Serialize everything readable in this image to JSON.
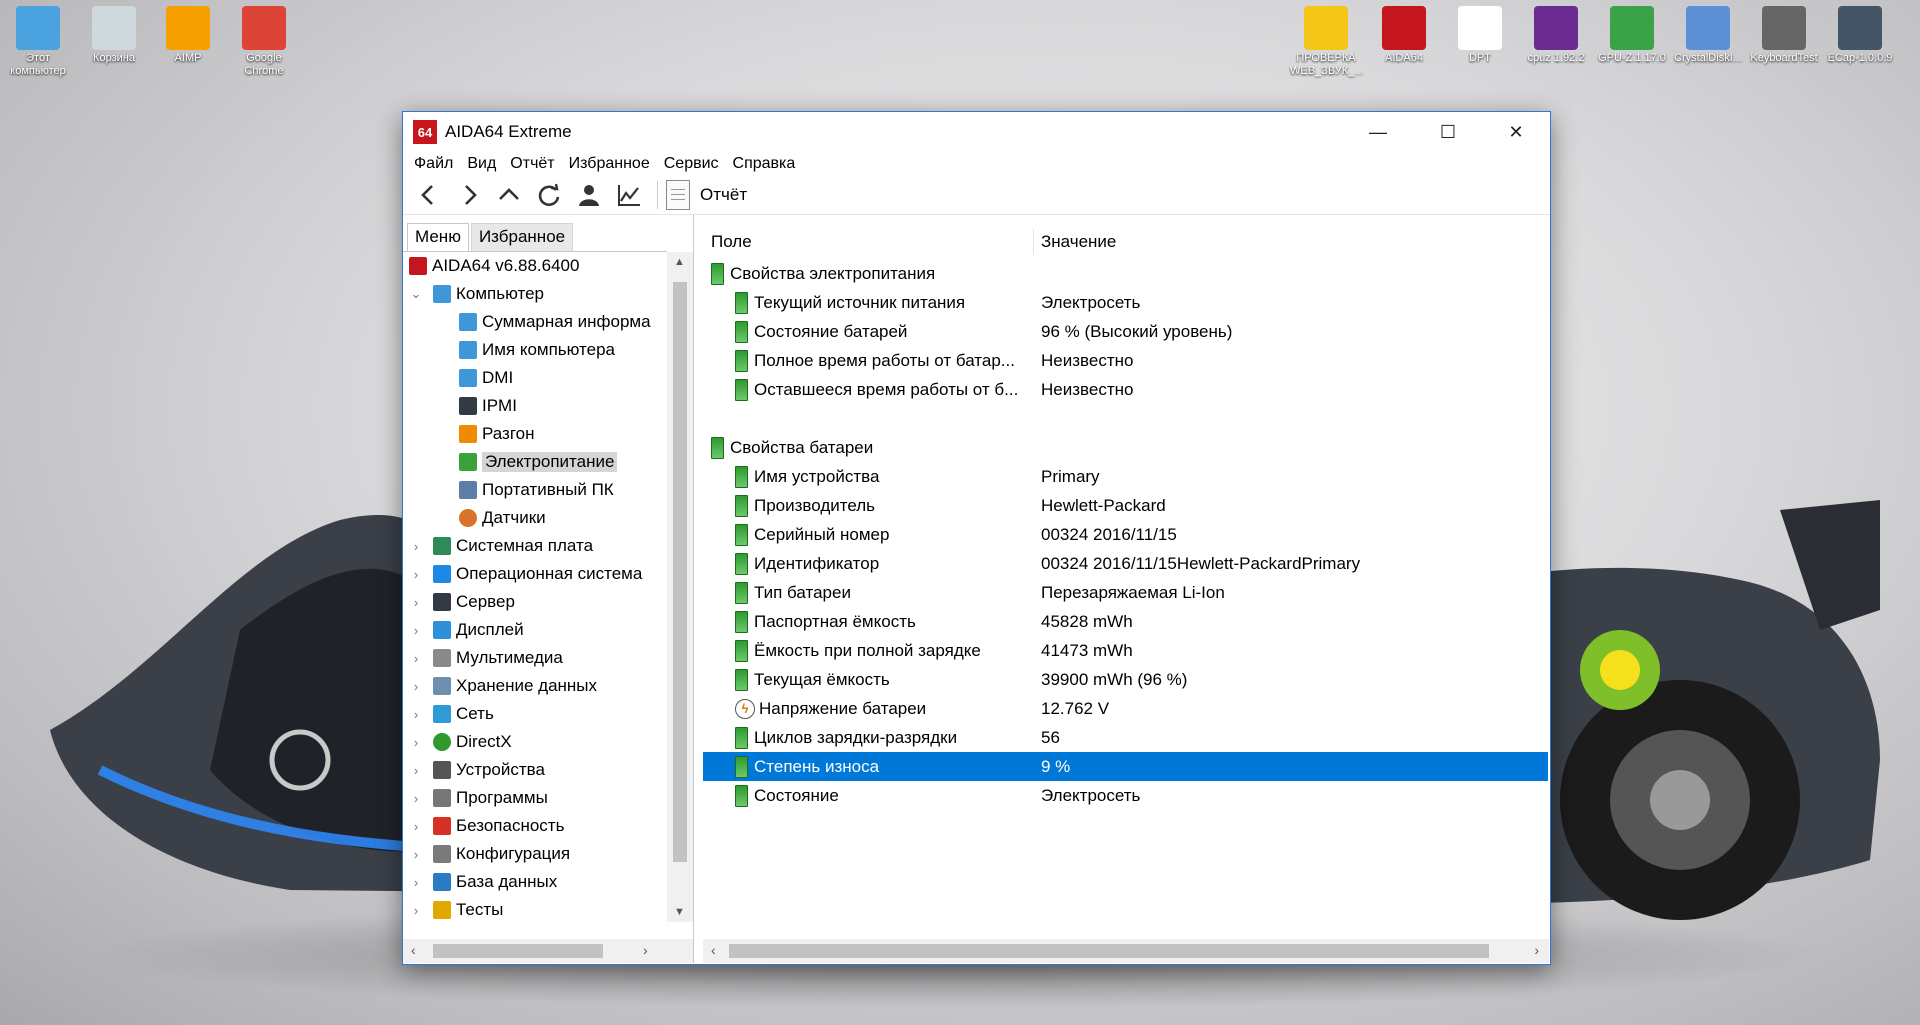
{
  "desktop_icons": [
    {
      "label": "Этот компьютер",
      "name": "this-pc-icon",
      "color": "#4aa3df"
    },
    {
      "label": "Корзина",
      "name": "recycle-bin-icon",
      "color": "#cfd8dc"
    },
    {
      "label": "AIMP",
      "name": "aimp-icon",
      "color": "#f5a000"
    },
    {
      "label": "Google Chrome",
      "name": "chrome-icon",
      "color": "#db4437"
    },
    {
      "label": "ПРОВЕРКА WEB_ЗВУК_...",
      "name": "warning-icon",
      "color": "#f5c518"
    },
    {
      "label": "AIDA64",
      "name": "aida64-icon",
      "color": "#c4161c"
    },
    {
      "label": "DPT",
      "name": "dpt-icon",
      "color": "#ffffff"
    },
    {
      "label": "cpuz 1.92.2",
      "name": "cpuz-icon",
      "color": "#6b2c91"
    },
    {
      "label": "GPU-Z.1.17.0",
      "name": "gpuz-icon",
      "color": "#3aa34a"
    },
    {
      "label": "CrystalDiskI...",
      "name": "crystaldisk-icon",
      "color": "#5b8fd6"
    },
    {
      "label": "KeyboardTest",
      "name": "keyboard-icon",
      "color": "#666666"
    },
    {
      "label": "ECap-1.0.0.9",
      "name": "camera-icon",
      "color": "#445566"
    }
  ],
  "window": {
    "title": "AIDA64 Extreme",
    "logo": "64",
    "controls": {
      "minimize": "—",
      "maximize": "☐",
      "close": "✕"
    }
  },
  "menu": [
    "Файл",
    "Вид",
    "Отчёт",
    "Избранное",
    "Сервис",
    "Справка"
  ],
  "toolbar": {
    "report_label": "Отчёт"
  },
  "tabs": {
    "menu": "Меню",
    "favorites": "Избранное"
  },
  "tree": [
    {
      "label": "AIDA64 v6.88.6400",
      "level": 0,
      "icon": "aida64-icon",
      "arrow": ""
    },
    {
      "label": "Компьютер",
      "level": 1,
      "icon": "computer-icon",
      "arrow": "⌄"
    },
    {
      "label": "Суммарная информа",
      "level": 2,
      "icon": "computer-icon",
      "arrow": ""
    },
    {
      "label": "Имя компьютера",
      "level": 2,
      "icon": "computer-icon",
      "arrow": ""
    },
    {
      "label": "DMI",
      "level": 2,
      "icon": "computer-icon",
      "arrow": ""
    },
    {
      "label": "IPMI",
      "level": 2,
      "icon": "server-icon",
      "arrow": ""
    },
    {
      "label": "Разгон",
      "level": 2,
      "icon": "flame-icon",
      "arrow": ""
    },
    {
      "label": "Электропитание",
      "level": 2,
      "icon": "battery-icon",
      "arrow": "",
      "selected": true
    },
    {
      "label": "Портативный ПК",
      "level": 2,
      "icon": "laptop-icon",
      "arrow": ""
    },
    {
      "label": "Датчики",
      "level": 2,
      "icon": "gauge-icon",
      "arrow": ""
    },
    {
      "label": "Системная плата",
      "level": 1,
      "icon": "motherboard-icon",
      "arrow": "›"
    },
    {
      "label": "Операционная система",
      "level": 1,
      "icon": "windows-icon",
      "arrow": "›"
    },
    {
      "label": "Сервер",
      "level": 1,
      "icon": "server-icon",
      "arrow": "›"
    },
    {
      "label": "Дисплей",
      "level": 1,
      "icon": "display-icon",
      "arrow": "›"
    },
    {
      "label": "Мультимедиа",
      "level": 1,
      "icon": "speaker-icon",
      "arrow": "›"
    },
    {
      "label": "Хранение данных",
      "level": 1,
      "icon": "storage-icon",
      "arrow": "›"
    },
    {
      "label": "Сеть",
      "level": 1,
      "icon": "network-icon",
      "arrow": "›"
    },
    {
      "label": "DirectX",
      "level": 1,
      "icon": "xbox-icon",
      "arrow": "›"
    },
    {
      "label": "Устройства",
      "level": 1,
      "icon": "devices-icon",
      "arrow": "›"
    },
    {
      "label": "Программы",
      "level": 1,
      "icon": "programs-icon",
      "arrow": "›"
    },
    {
      "label": "Безопасность",
      "level": 1,
      "icon": "shield-icon",
      "arrow": "›"
    },
    {
      "label": "Конфигурация",
      "level": 1,
      "icon": "config-icon",
      "arrow": "›"
    },
    {
      "label": "База данных",
      "level": 1,
      "icon": "database-icon",
      "arrow": "›"
    },
    {
      "label": "Тесты",
      "level": 1,
      "icon": "tests-icon",
      "arrow": "›"
    }
  ],
  "columns": {
    "field": "Поле",
    "value": "Значение"
  },
  "rows": [
    {
      "field": "Свойства электропитания",
      "value": "",
      "group": true
    },
    {
      "field": "Текущий источник питания",
      "value": "Электросеть"
    },
    {
      "field": "Состояние батарей",
      "value": "96 % (Высокий уровень)"
    },
    {
      "field": "Полное время работы от батар...",
      "value": "Неизвестно"
    },
    {
      "field": "Оставшееся время работы от б...",
      "value": "Неизвестно"
    },
    {
      "field": "",
      "value": "",
      "spacer": true
    },
    {
      "field": "Свойства батареи",
      "value": "",
      "group": true
    },
    {
      "field": "Имя устройства",
      "value": "Primary"
    },
    {
      "field": "Производитель",
      "value": "Hewlett-Packard"
    },
    {
      "field": "Серийный номер",
      "value": "00324 2016/11/15"
    },
    {
      "field": "Идентификатор",
      "value": "00324 2016/11/15Hewlett-PackardPrimary"
    },
    {
      "field": "Тип батареи",
      "value": "Перезаряжаемая Li-Ion"
    },
    {
      "field": "Паспортная ёмкость",
      "value": "45828 mWh"
    },
    {
      "field": "Ёмкость при полной зарядке",
      "value": "41473 mWh"
    },
    {
      "field": "Текущая ёмкость",
      "value": "39900 mWh  (96 %)"
    },
    {
      "field": "Напряжение батареи",
      "value": "12.762 V",
      "icon": "voltage"
    },
    {
      "field": "Циклов зарядки-разрядки",
      "value": "56"
    },
    {
      "field": "Степень износа",
      "value": "9 %",
      "highlight": true
    },
    {
      "field": "Состояние",
      "value": "Электросеть"
    }
  ],
  "colors": {
    "accent": "#0078d7",
    "aida_red": "#c4161c"
  }
}
